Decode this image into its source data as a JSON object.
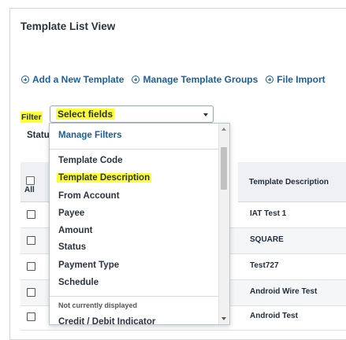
{
  "page": {
    "title": "Template List View"
  },
  "actions": [
    {
      "label": "Add a New Template",
      "icon": "plus-circle-icon"
    },
    {
      "label": "Manage Template Groups",
      "icon": "plus-circle-icon"
    },
    {
      "label": "File Import",
      "icon": "plus-circle-icon"
    }
  ],
  "filter": {
    "label": "Filter",
    "select_value": "Select fields",
    "status_fragment": "Statu",
    "highlight_color": "#ffff33"
  },
  "table": {
    "select_all_label": "All",
    "column_description": "Template Description",
    "rows": [
      {
        "description": "IAT Test 1"
      },
      {
        "description": "SQUARE"
      },
      {
        "description": "Test727"
      },
      {
        "description": "Android Wire Test"
      },
      {
        "description": "Android Test"
      }
    ]
  },
  "dropdown": {
    "manage_filters": "Manage Filters",
    "items": [
      {
        "label": "Template Code"
      },
      {
        "label": "Template Description",
        "highlighted": true
      },
      {
        "label": "From Account"
      },
      {
        "label": "Payee"
      },
      {
        "label": "Amount"
      },
      {
        "label": "Status"
      },
      {
        "label": "Payment Type"
      },
      {
        "label": "Schedule"
      }
    ],
    "section_not_displayed": "Not currently displayed",
    "partial_item": "Credit / Debit Indicator"
  },
  "colors": {
    "link": "#1b5e9c",
    "text": "#1f2d3d",
    "highlight": "#ffff33"
  }
}
